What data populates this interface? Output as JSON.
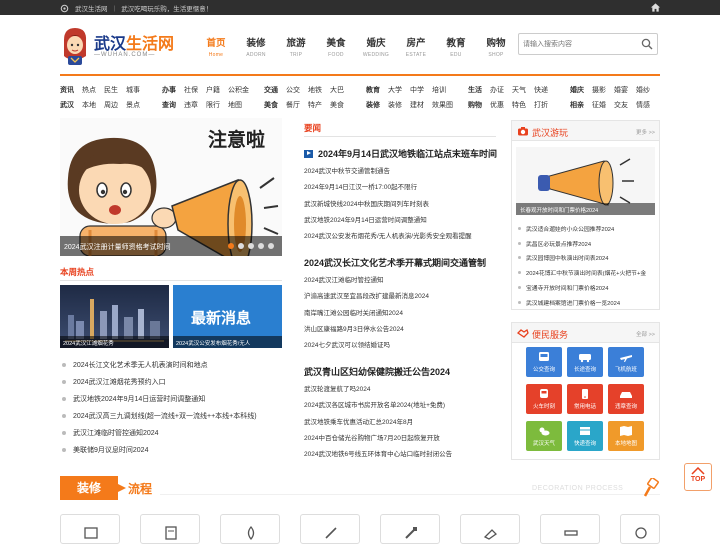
{
  "topbar": {
    "site": "武汉生活网",
    "slogan": "武汉吃喝玩乐购，生活更惬意！"
  },
  "logo": {
    "part1": "武汉",
    "part2": "生活网",
    "domain": "—WUHAN.COM—"
  },
  "mainnav": [
    {
      "cn": "首页",
      "en": "Home"
    },
    {
      "cn": "装修",
      "en": "ADORN"
    },
    {
      "cn": "旅游",
      "en": "TRIP"
    },
    {
      "cn": "美食",
      "en": "FOOD"
    },
    {
      "cn": "婚庆",
      "en": "WEDDING"
    },
    {
      "cn": "房产",
      "en": "ESTATE"
    },
    {
      "cn": "教育",
      "en": "EDU"
    },
    {
      "cn": "购物",
      "en": "SHOP"
    }
  ],
  "search": {
    "placeholder": "请输入搜索内容"
  },
  "categories": {
    "row1": [
      {
        "head": "资讯",
        "items": [
          "热点",
          "民生",
          "城事"
        ]
      },
      {
        "head": "办事",
        "items": [
          "社保",
          "户籍",
          "公积金"
        ]
      },
      {
        "head": "交通",
        "items": [
          "公交",
          "地铁",
          "大巴"
        ]
      },
      {
        "head": "教育",
        "items": [
          "大学",
          "中学",
          "培训"
        ]
      },
      {
        "head": "生活",
        "items": [
          "办证",
          "天气",
          "快递"
        ]
      },
      {
        "head": "婚庆",
        "items": [
          "摄影",
          "婚宴",
          "婚纱"
        ]
      }
    ],
    "row2": [
      {
        "head": "武汉",
        "items": [
          "本地",
          "周边",
          "景点"
        ]
      },
      {
        "head": "查询",
        "items": [
          "违章",
          "限行",
          "地图"
        ]
      },
      {
        "head": "美食",
        "items": [
          "餐厅",
          "特产",
          "美食"
        ]
      },
      {
        "head": "装修",
        "items": [
          "装修",
          "建材",
          "效果图"
        ]
      },
      {
        "head": "购物",
        "items": [
          "优惠",
          "特色",
          "打折"
        ]
      },
      {
        "head": "相亲",
        "items": [
          "征婚",
          "交友",
          "情感"
        ]
      }
    ]
  },
  "slider": {
    "image_text": "注意啦",
    "caption": "2024武汉注册计量师资格考试时间"
  },
  "hot": {
    "title": "本周热点",
    "thumbs": [
      "2024武汉江滩烟花秀",
      "2024武汉公安发布烟花秀/无人"
    ],
    "more_hint": "最新消息",
    "items": [
      "2024长江文化艺术季无人机表演时间和地点",
      "2024武汉江滩烟花秀预约入口",
      "武汉地铁2024年9月14日运营时间调整通知",
      "2024武汉高三九调划线(超一流线+双一流线++本线+本科线)",
      "武汉江滩临时管控通知2024",
      "美联储9月议息时间2024"
    ]
  },
  "news": {
    "label": "要闻",
    "groups": [
      {
        "headline": "2024年9月14日武汉地铁临江站点末班车时间",
        "items": [
          "2024武汉中秋节交通管制通告",
          "2024年9月14日江汉一桥17:00起不限行",
          "武汉新城快线2024中秋国庆期间列车时刻表",
          "武汉地铁2024年9月14日运营时间调整通知",
          "2024武汉公安发布烟花秀/无人机表演/光影秀安全观看提醒"
        ]
      },
      {
        "headline": "2024武汉长江文化艺术季开幕式期间交通管制",
        "items": [
          "2024武汉江滩临时管控通知",
          "沪渝高速武汉至宜昌段改扩建最新消息2024",
          "南岸嘴江滩公园临时关闭通知2024",
          "洪山区康福路9月3日停水公告2024",
          "2024七夕武汉可以领结婚证吗"
        ]
      },
      {
        "headline": "武汉青山区妇幼保健院搬迁公告2024",
        "items": [
          "武汉轮渡复航了吗2024",
          "2024武汉各区城市书房开放名单2024(地址+免费)",
          "武汉地铁乘车优惠活动汇总2024年8月",
          "2024中百仓储光谷购物广场7月20日起恢复开放",
          "2024武汉地铁6号线五环体育中心站口临时封闭公告"
        ]
      }
    ]
  },
  "play": {
    "title": "武汉游玩",
    "more": "更多 >>",
    "image_caption": "长春观开放时间和门票价格2024",
    "items": [
      "武汉适合遛娃的小众公园推荐2024",
      "武昌区必玩景点推荐2024",
      "武汉园博园中秋演出时间表2024",
      "2024花博汇中秋节演出时间表(烟花+火把节+金",
      "宝通寺开放时间和门票价格2024",
      "武汉城建档案馆进门票价格一览2024"
    ]
  },
  "service": {
    "title": "便民服务",
    "more": "全部 >>",
    "items": [
      {
        "label": "公交查询",
        "color": "#3b7fd8"
      },
      {
        "label": "长途查询",
        "color": "#3b7fd8"
      },
      {
        "label": "飞机航班",
        "color": "#3b7fd8"
      },
      {
        "label": "火车时刻",
        "color": "#e5412a"
      },
      {
        "label": "常用电话",
        "color": "#e5412a"
      },
      {
        "label": "违章查询",
        "color": "#e5412a"
      },
      {
        "label": "武汉天气",
        "color": "#7dbb3d"
      },
      {
        "label": "快递查询",
        "color": "#2aa6c9"
      },
      {
        "label": "本地地图",
        "color": "#f09a2a"
      }
    ]
  },
  "decoration": {
    "tag": "装修",
    "title": "流程",
    "en": "DECORATION PROCESS"
  },
  "top_button": "TOP",
  "colors": {
    "accent": "#f47a1a",
    "red": "#e8411e",
    "topbar": "#2f2f2f",
    "logo_blue": "#1a3a8a"
  }
}
